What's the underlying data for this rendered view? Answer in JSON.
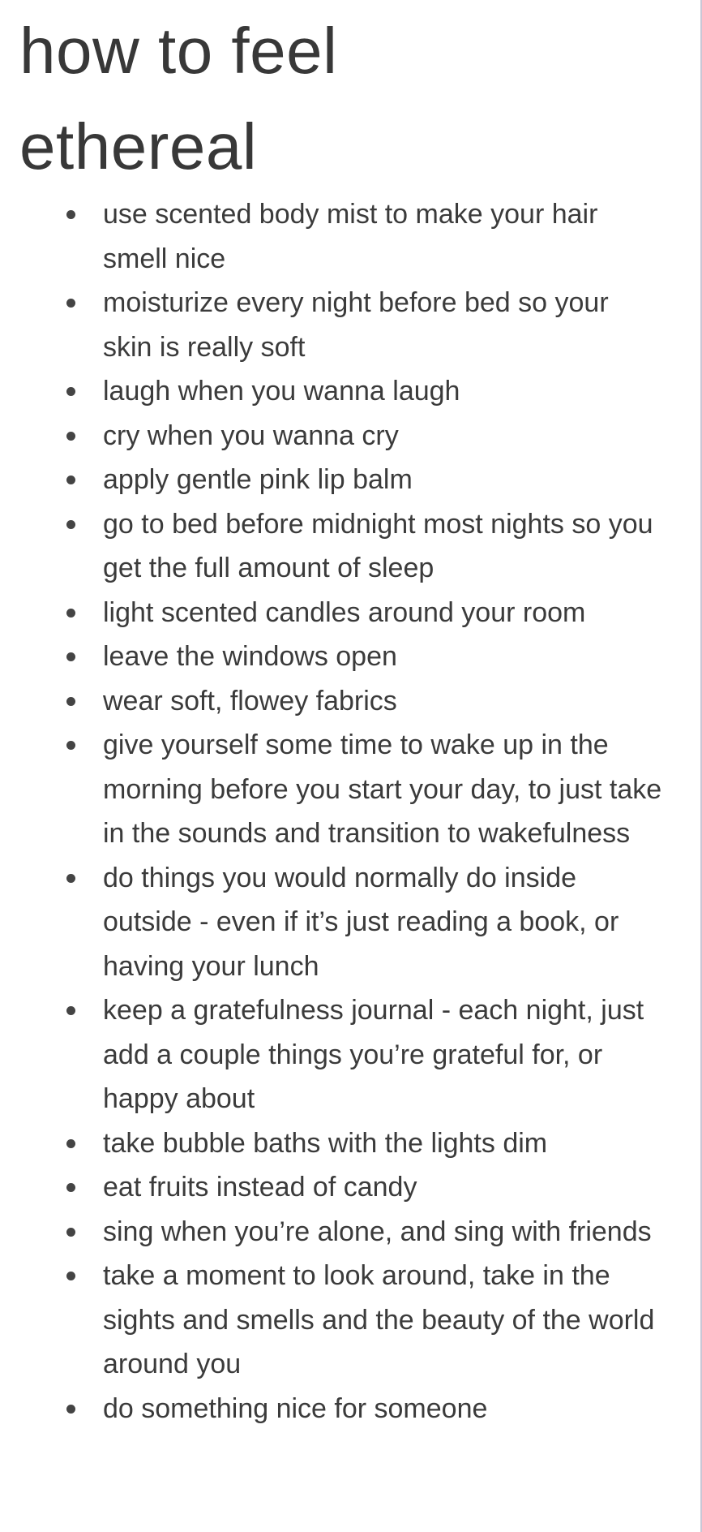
{
  "title_line1": "how to feel",
  "title_line2": "ethereal",
  "items": [
    "use scented body mist to make your hair smell nice",
    "moisturize every night before bed so your skin is really soft",
    "laugh when you wanna laugh",
    "cry when you wanna cry",
    "apply gentle pink lip balm",
    "go to bed before midnight most nights so you get the full amount of sleep",
    "light scented candles around your room",
    "leave the windows open",
    "wear soft, flowey fabrics",
    "give yourself some time to wake up in the morning before you start your day, to just take in the sounds and transition to wakefulness",
    "do things you would normally do inside outside - even if it’s just reading a book, or having your lunch",
    "keep a gratefulness journal - each night, just add a couple things you’re grateful for, or happy about",
    "take bubble baths with the lights dim",
    "eat fruits instead of candy",
    "sing when you’re alone, and sing with friends",
    "take a moment to look around, take in the sights and smells and the beauty of the world around you",
    "do something nice for someone"
  ]
}
